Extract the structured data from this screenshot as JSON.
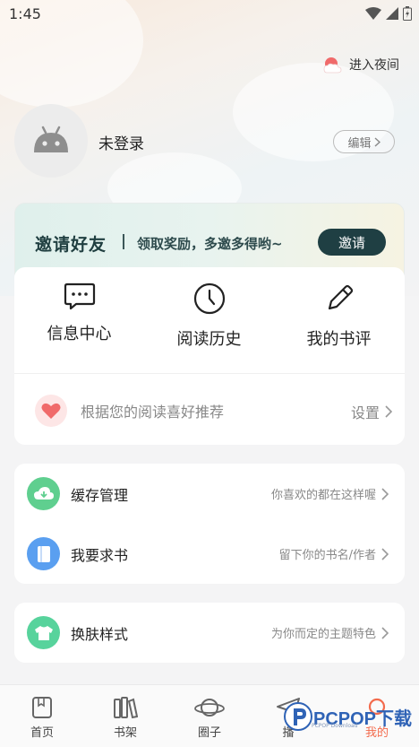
{
  "status_bar": {
    "time": "1:45"
  },
  "header": {
    "night_mode_label": "进入夜间"
  },
  "profile": {
    "username": "未登录",
    "edit_label": "编辑"
  },
  "invite": {
    "title": "邀请好友",
    "subtitle": "领取奖励，多邀多得哟~",
    "button_label": "邀请"
  },
  "quick_actions": [
    {
      "label": "信息中心",
      "icon": "message-icon"
    },
    {
      "label": "阅读历史",
      "icon": "clock-icon"
    },
    {
      "label": "我的书评",
      "icon": "pencil-icon"
    }
  ],
  "recommendation": {
    "text": "根据您的阅读喜好推荐",
    "setting_label": "设置"
  },
  "list_group_1": [
    {
      "label": "缓存管理",
      "hint": "你喜欢的都在这样喔",
      "icon": "download-cloud-icon",
      "color": "#5fcf8f"
    },
    {
      "label": "我要求书",
      "hint": "留下你的书名/作者",
      "icon": "book-icon",
      "color": "#5a9ff0"
    }
  ],
  "list_group_2": [
    {
      "label": "换肤样式",
      "hint": "为你而定的主题特色",
      "icon": "shirt-icon",
      "color": "#57d39c"
    }
  ],
  "bottom_nav": [
    {
      "label": "首页",
      "icon": "home-book-icon"
    },
    {
      "label": "书架",
      "icon": "bookshelf-icon"
    },
    {
      "label": "圈子",
      "icon": "planet-icon"
    },
    {
      "label": "播",
      "icon": "send-icon"
    },
    {
      "label": "我的",
      "icon": "profile-circle-icon"
    }
  ],
  "watermark": {
    "text": "PCPOP下载",
    "small_text": "PCPOP Download"
  },
  "colors": {
    "accent": "#f36b4d",
    "invite_button": "#1f3f43",
    "brand_green": "#57d39c"
  }
}
